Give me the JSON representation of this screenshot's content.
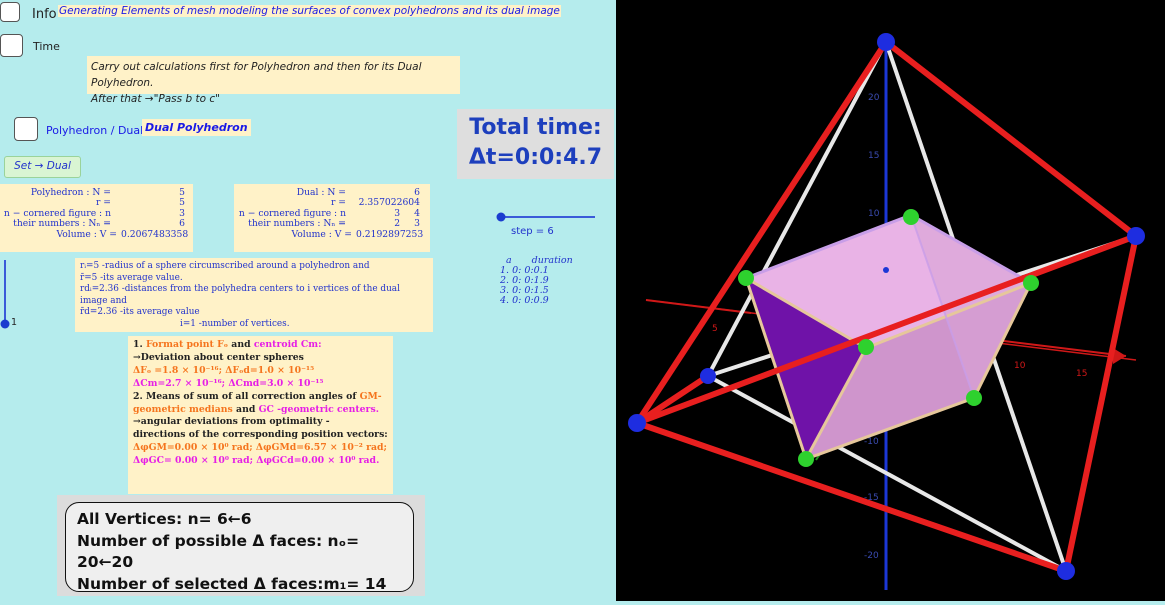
{
  "controls": {
    "info_label": "Info",
    "header_title": "Generating Elements of mesh modeling the surfaces of convex polyhedrons and its dual image",
    "time_label": "Time",
    "instruction_line1": "Carry out calculations first for Polyhedron and then for its Dual Polyhedron.",
    "instruction_line2": "After that →\"Pass b to c\"",
    "polyhedron_dual_label": "Polyhedron / Dual",
    "dual_polyhedron_tag": "Dual Polyhedron",
    "set_dual_button": "Set → Dual"
  },
  "total_time": {
    "line1": "Total time:",
    "line2": "Δt=0:0:4.7"
  },
  "polyhedron": {
    "n_label": "Polyhedron : N =",
    "n_value": "5",
    "r_label": "r =",
    "r_value": "5",
    "ncorner_label": "n − cornered figure : n =",
    "ncorner_value": "3",
    "numbers_label": "their numbers : Nₙ =",
    "numbers_value": "6",
    "volume_label": "Volume : V =",
    "volume_value": "0.2067483358"
  },
  "dual": {
    "n_label": "Dual : N =",
    "n_value": "6",
    "r_label": "r =",
    "r_value": "2.357022604",
    "ncorner_label": "n − cornered figure : n =",
    "ncorner_value_1": "3",
    "ncorner_value_2": "4",
    "numbers_label": "their numbers : Nₙ =",
    "numbers_value_1": "2",
    "numbers_value_2": "3",
    "volume_label": "Volume : V =",
    "volume_value": "0.2192897253"
  },
  "step": {
    "label": "step = 6"
  },
  "durations": {
    "header_a": "a",
    "header_duration": "duration",
    "rows": [
      "1.  0: 0:0.1",
      "2.  0: 0:1.9",
      "3.  0: 0:1.5",
      "4.  0: 0:0.9"
    ]
  },
  "left_slider": {
    "value": "1"
  },
  "definitions": {
    "line1": "rᵢ=5 -radius of a sphere circumscribed around a polyhedron and",
    "line2": "r̄=5 -its average value.",
    "line3": "rdᵢ=2.36 -distances from the polyhedra centers to i vertices of the dual image and",
    "line4": "r̄d=2.36 -its average value",
    "line5": "i=1   -number of  vertices."
  },
  "stats": {
    "t1_prefix": "1.",
    "t1_format": "Format point",
    "t1_fo": "Fₒ",
    "t1_and": "and",
    "t1_centroid": "centroid Cm:",
    "t1_dev": "→Deviation about center spheres",
    "d1": "ΔFₒ =1.8 × 10⁻¹⁶;  ΔFₒd=1.0 × 10⁻¹⁵",
    "d2": "ΔCm=2.7 × 10⁻¹⁶;  ΔCmd=3.0 × 10⁻¹⁵",
    "t2_prefix": "2. Means of sum of all correction angles of",
    "t2_gm": "GM-",
    "t2_gm2": "geometric medians",
    "t2_and": "and",
    "t2_gc": "GC -geometric centers.",
    "t2_line3": "→angular deviations from optimality -",
    "t2_line4": "directions of the corresponding position vectors:",
    "a1": "ΔφGM=0.00 × 10⁰  rad;  ΔφGMd=6.57 × 10⁻² rad;",
    "a2": "ΔφGC= 0.00 × 10⁰  rad;   ΔφGCd=0.00 × 10⁰ rad."
  },
  "vertices": {
    "line1": "All Vertices: n= 6←6",
    "line2": "Number of possible Δ faces: nₒ= 20←20",
    "line3": "Number of selected Δ faces:m₁= 14"
  },
  "view3d": {
    "axis_labels": [
      "20",
      "15",
      "10",
      "5",
      "-10",
      "-15",
      "-20",
      "5",
      "10",
      "15",
      "5",
      "10",
      "15"
    ],
    "colors": {
      "edge_red": "#e81f1f",
      "edge_white": "#e8e8e8",
      "edge_tan": "#e6c79b",
      "vertex_blue": "#1e2de0",
      "vertex_green": "#2ed12e",
      "face_pink": "#e9b3e6",
      "face_purple": "#6f12a8",
      "axis_blue": "#1c37d6"
    }
  }
}
